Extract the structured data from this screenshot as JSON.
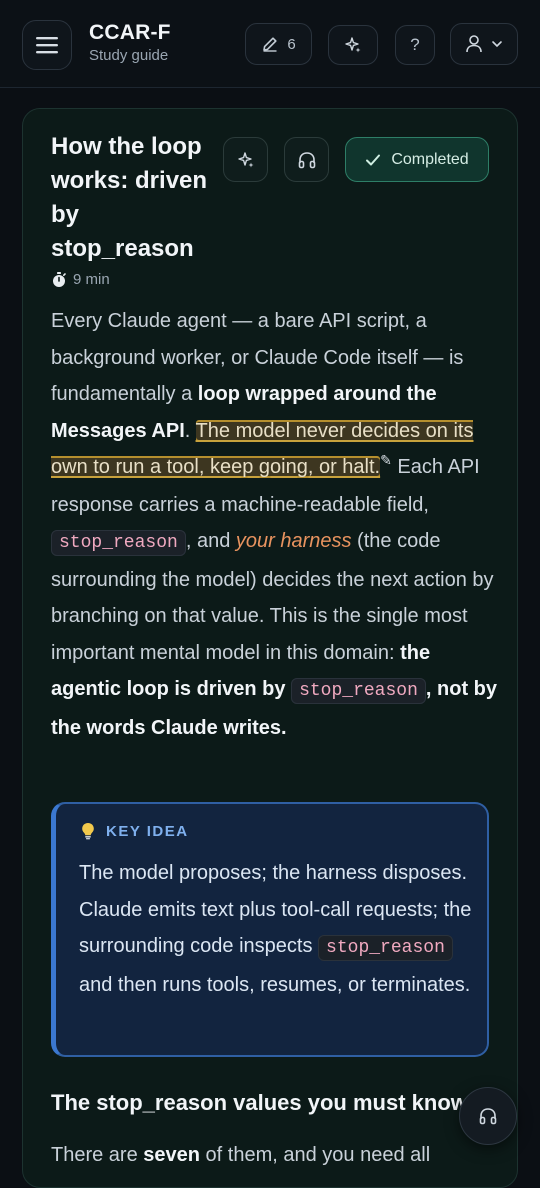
{
  "header": {
    "title": "CCAR-F",
    "subtitle": "Study guide",
    "notes_count": "6",
    "help_label": "?"
  },
  "lesson": {
    "title": "How the loop works: driven by stop_reason",
    "duration": "9 min",
    "completed_label": "Completed",
    "body": {
      "p1": "Every Claude agent — a bare API script, a background worker, or Claude Code itself — is fundamentally a ",
      "b1": "loop wrapped around the Messages API",
      "p2": ". ",
      "highlight": "The model never decides on its own to run a tool, keep going, or halt.",
      "p3": " Each API response carries a machine-readable field, ",
      "code1": "stop_reason",
      "p4": ", and ",
      "em1": "your harness",
      "p5": " (the code surrounding the model) decides the next action by branching on that value. This is the single most important mental model in this domain: ",
      "b2": "the agentic loop is driven by ",
      "code2": "stop_reason",
      "b3": ", not by the words Claude writes."
    },
    "key_idea": {
      "label": "KEY IDEA",
      "t1": "The model proposes; the harness disposes. Claude emits text plus tool-call requests; the surrounding code inspects ",
      "code": "stop_reason",
      "t2": " and then runs tools, resumes, or terminates."
    },
    "section": {
      "heading": "The stop_reason values you must know",
      "intro1": "There are ",
      "intro_b": "seven",
      "intro2": " of them, and you need all"
    }
  },
  "icons": [
    "menu-icon",
    "pencil-icon",
    "sparkle-icon",
    "user-icon",
    "chevron-down-icon",
    "headphones-icon",
    "check-icon",
    "stopwatch-icon",
    "lightbulb-icon",
    "edit-note-icon"
  ],
  "colors": {
    "accent_green": "#2e7e67",
    "highlight": "#c8a23c",
    "callout_border": "#3b78d0",
    "code_text": "#f0a9c0",
    "emphasis": "#e8935f"
  }
}
